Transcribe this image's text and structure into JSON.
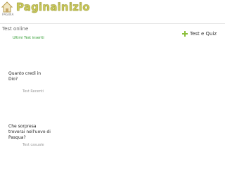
{
  "header": {
    "logo_text": "Paginainizio",
    "home_label": "PAGINA"
  },
  "section": {
    "title": "Test online",
    "subtitle": "Ultimi Test inseriti",
    "quiz_link": "Test e Quiz"
  },
  "items": [
    {
      "title": "Quanto credi in Dio?",
      "label": "Test Recenti"
    },
    {
      "title": "Che sorpresa troverai nell'uovo di Pasqua?",
      "label": "Test casuale"
    }
  ],
  "colors": {
    "logo": "#c9c85a",
    "accent_green": "#2e9b2e",
    "plus_icon": "#8bbf3a"
  }
}
